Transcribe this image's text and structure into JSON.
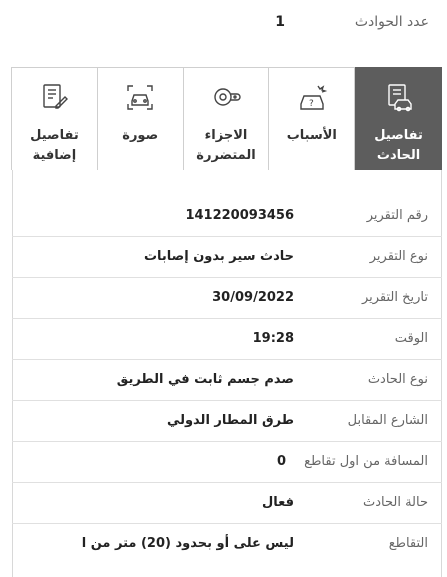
{
  "accident_count": {
    "label": "عدد الحوادث",
    "value": "1"
  },
  "tabs": [
    {
      "id": "details",
      "label": "تفاصيل\nالحادث",
      "icon": "accident-report-icon",
      "active": true
    },
    {
      "id": "causes",
      "label": "الأسباب",
      "icon": "question-car-icon",
      "active": false
    },
    {
      "id": "damaged_parts",
      "label": "الاجزاء\nالمتضررة",
      "icon": "car-parts-icon",
      "active": false
    },
    {
      "id": "photo",
      "label": "صورة",
      "icon": "car-photo-icon",
      "active": false
    },
    {
      "id": "extra",
      "label": "تفاصيل\nإضافية",
      "icon": "edit-document-icon",
      "active": false
    }
  ],
  "details": [
    {
      "label": "رقم التقرير",
      "value": "141220093456"
    },
    {
      "label": "نوع التقرير",
      "value": "حادث سير بدون إصابات"
    },
    {
      "label": "تاريخ التقرير",
      "value": "30/09/2022"
    },
    {
      "label": "الوقت",
      "value": "19:28"
    },
    {
      "label": "نوع الحادث",
      "value": "صدم جسم ثابت في الطريق"
    },
    {
      "label": "الشارع المقابل",
      "value": "طرق المطار الدولي"
    },
    {
      "label": "المسافة من اول تقاطع",
      "value": "0"
    },
    {
      "label": "حالة الحادث",
      "value": "فعال"
    },
    {
      "label": "التقاطع",
      "value": "ليس على أو بحدود (20) متر من ا"
    }
  ],
  "colors": {
    "active_tab": "#5d5d5d",
    "border": "#cfcfcf",
    "label": "#666666"
  }
}
